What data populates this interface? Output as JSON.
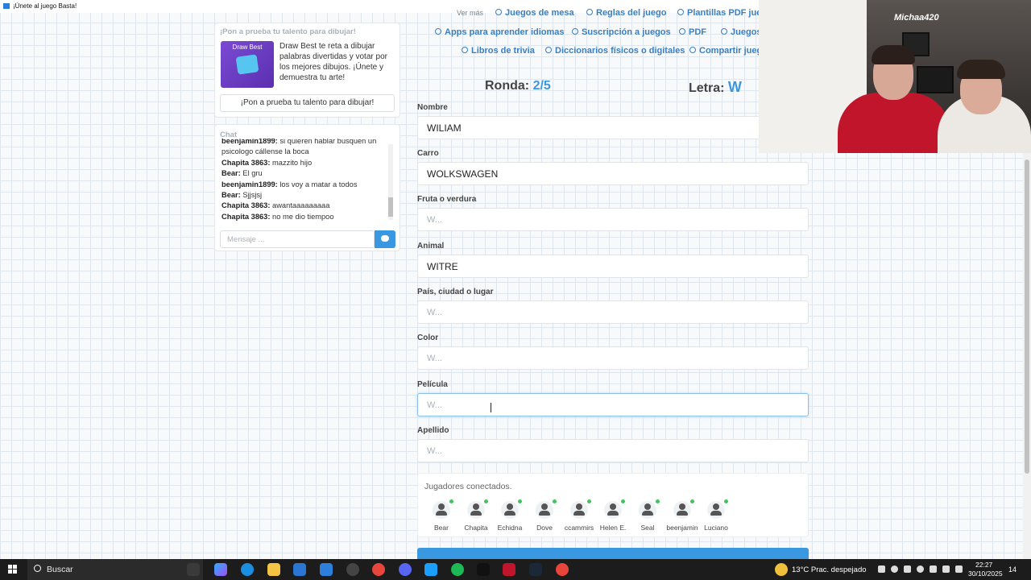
{
  "window": {
    "title": "¡Únete al juego Basta!"
  },
  "promo": {
    "header": "¡Pon a prueba tu talento para dibujar!",
    "thumb_title": "Draw Best",
    "description": "Draw Best te reta a dibujar palabras divertidas y votar por los mejores dibujos. ¡Únete y demuestra tu arte!",
    "button": "¡Pon a prueba tu talento para dibujar!"
  },
  "chat": {
    "header": "Chat",
    "messages": [
      {
        "user": "beenjamin1899:",
        "text": " si quieren hablar busquen un"
      },
      {
        "user": "",
        "text": "psicologo cállense la boca"
      },
      {
        "user": "Chapita 3863:",
        "text": " mazzito hijo"
      },
      {
        "user": "Bear:",
        "text": " El gru"
      },
      {
        "user": "beenjamin1899:",
        "text": " los voy a matar a todos"
      },
      {
        "user": "Bear:",
        "text": " Sjjsjsj"
      },
      {
        "user": "Chapita 3863:",
        "text": " awantaaaaaaaaa"
      },
      {
        "user": "Chapita 3863:",
        "text": " no me dio tiempoo"
      }
    ],
    "placeholder": "Mensaje ..."
  },
  "links": [
    {
      "label": "Ver más"
    },
    {
      "label": "Juegos de mesa"
    },
    {
      "label": "Reglas del juego"
    },
    {
      "label": "Plantillas PDF jueg"
    },
    {
      "label": "Apps para aprender idiomas"
    },
    {
      "label": "Suscripción a juegos"
    },
    {
      "label": "PDF"
    },
    {
      "label": "Juegos"
    },
    {
      "label": "Libros de trivia"
    },
    {
      "label": "Diccionarios físicos o digitales"
    },
    {
      "label": "Compartir juego"
    }
  ],
  "game": {
    "round_label": "Ronda:",
    "round_value": "2/5",
    "letter_label": "Letra:",
    "letter_value": "W"
  },
  "fields": [
    {
      "label": "Nombre",
      "value": "WILIAM",
      "placeholder": "W..."
    },
    {
      "label": "Carro",
      "value": "WOLKSWAGEN",
      "placeholder": "W..."
    },
    {
      "label": "Fruta o verdura",
      "value": "",
      "placeholder": "W..."
    },
    {
      "label": "Animal",
      "value": "WITRE",
      "placeholder": "W..."
    },
    {
      "label": "País, ciudad o lugar",
      "value": "",
      "placeholder": "W..."
    },
    {
      "label": "Color",
      "value": "",
      "placeholder": "W..."
    },
    {
      "label": "Película",
      "value": "",
      "placeholder": "W..."
    },
    {
      "label": "Apellido",
      "value": "",
      "placeholder": "W..."
    }
  ],
  "players": {
    "title": "Jugadores conectados.",
    "list": [
      "Bear",
      "Chapita",
      "Echidna",
      "Dove",
      "ccammirs",
      "Helen E.",
      "Seal",
      "beenjamin",
      "Luciano"
    ]
  },
  "webcam": {
    "tag": "Michaa420"
  },
  "taskbar": {
    "search": "Buscar",
    "weather": "13°C  Prac. despejado",
    "time": "22:27",
    "date": "30/10/2025",
    "notifications": "14"
  },
  "colors": {
    "accent": "#3a98e0",
    "online": "#46c35f",
    "liverpool_red": "#c0152b"
  }
}
